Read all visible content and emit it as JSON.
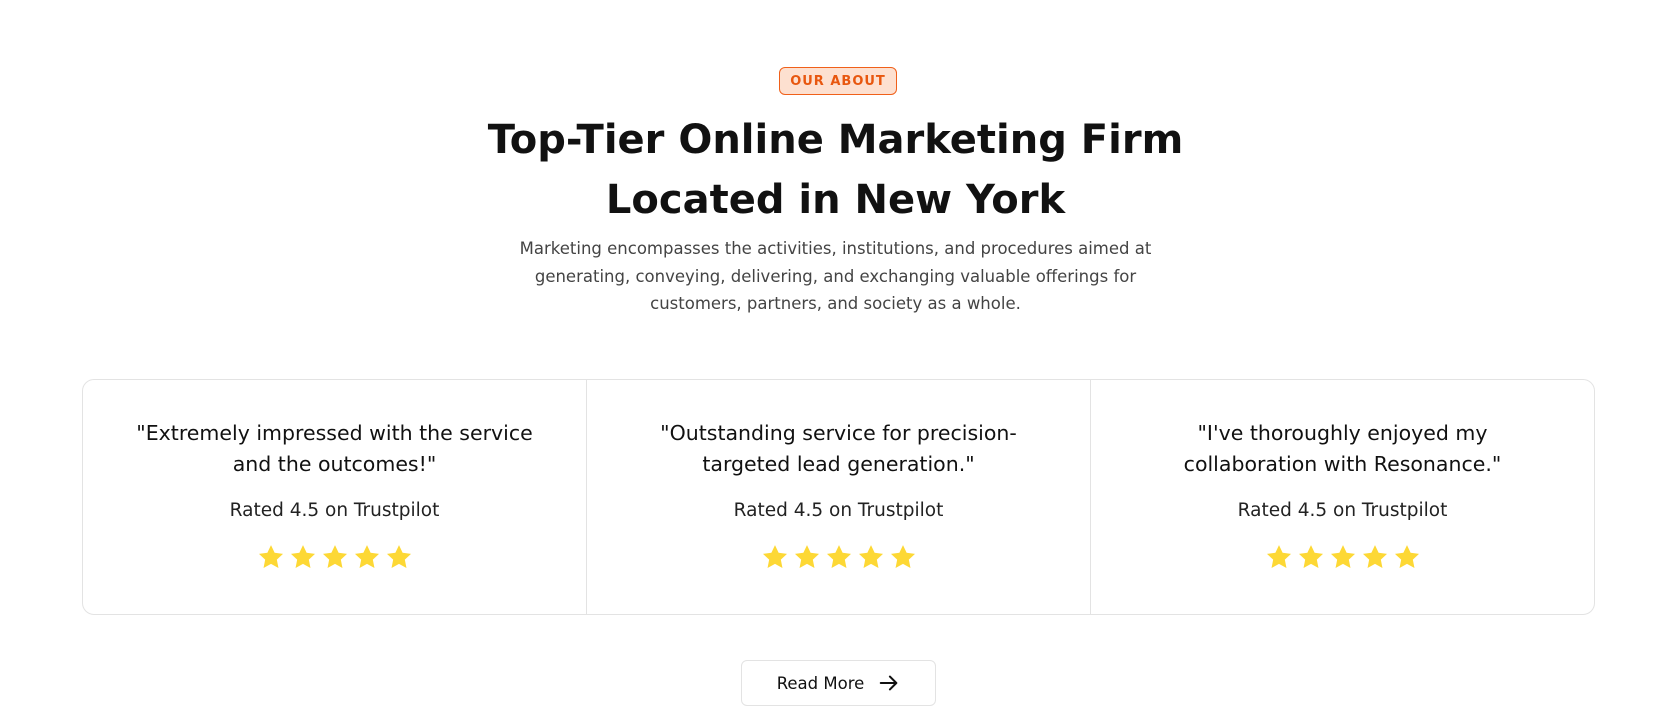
{
  "section": {
    "badge": "OUR ABOUT",
    "title_line1": "Top-Tier Online Marketing Firm",
    "title_line2": "Located in New York",
    "description": "Marketing encompasses the activities, institutions, and procedures aimed at generating, conveying, delivering, and exchanging valuable offerings for customers, partners, and society as a whole."
  },
  "testimonials": [
    {
      "quote": "\"Extremely impressed with the service and the outcomes!\"",
      "rating_text": "Rated 4.5 on Trustpilot",
      "stars": 5
    },
    {
      "quote": "\"Outstanding service for precision-targeted lead generation.\"",
      "rating_text": "Rated 4.5 on Trustpilot",
      "stars": 5
    },
    {
      "quote": "\"I've thoroughly enjoyed my collaboration with Resonance.\"",
      "rating_text": "Rated 4.5 on Trustpilot",
      "stars": 5
    }
  ],
  "read_more": {
    "label": "Read More",
    "icon": "arrow-right-icon"
  },
  "colors": {
    "accent": "#e8570f",
    "badge_bg": "#fde0d0",
    "star": "#fdd835"
  }
}
